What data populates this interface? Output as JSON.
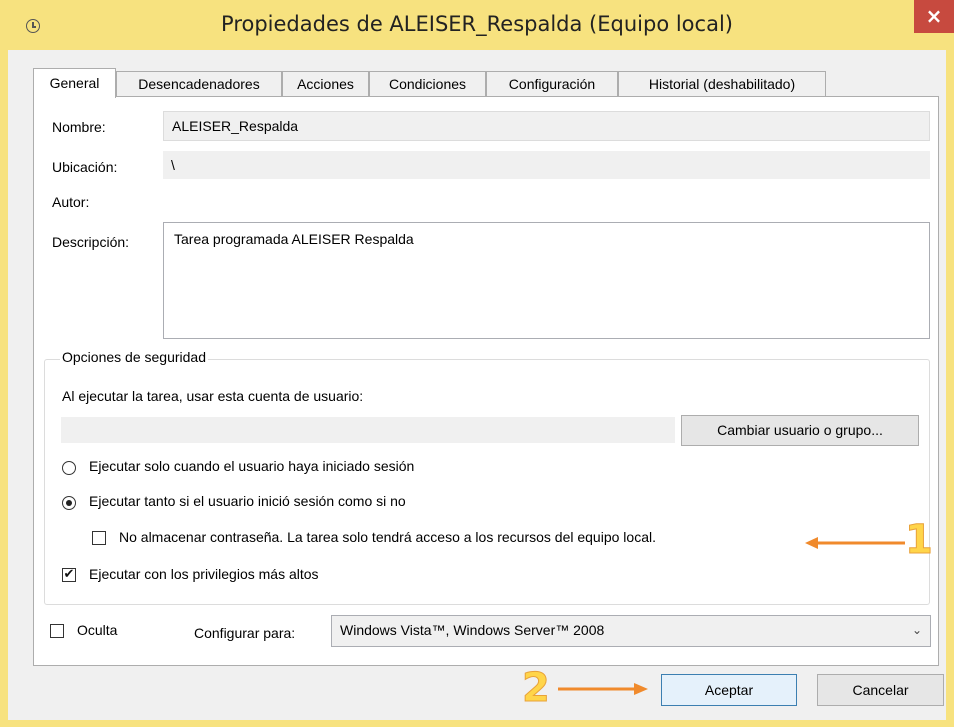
{
  "window": {
    "title": "Propiedades de ALEISER_Respalda (Equipo local)",
    "close_glyph": "×",
    "clock_icon": "clock-icon"
  },
  "tabs": [
    {
      "label": "General",
      "active": true
    },
    {
      "label": "Desencadenadores",
      "active": false
    },
    {
      "label": "Acciones",
      "active": false
    },
    {
      "label": "Condiciones",
      "active": false
    },
    {
      "label": "Configuración",
      "active": false
    },
    {
      "label": "Historial (deshabilitado)",
      "active": false
    }
  ],
  "general": {
    "name_label": "Nombre:",
    "name_value": "ALEISER_Respalda",
    "location_label": "Ubicación:",
    "location_value": "\\",
    "author_label": "Autor:",
    "author_value": "",
    "description_label": "Descripción:",
    "description_value": "Tarea programada ALEISER Respalda"
  },
  "security": {
    "group_title": "Opciones de seguridad",
    "account_prompt": "Al ejecutar la tarea, usar esta cuenta de usuario:",
    "account_value": "",
    "change_user_button": "Cambiar usuario o grupo...",
    "radio_logged_on": "Ejecutar solo cuando el usuario haya iniciado sesión",
    "radio_logged_on_selected": false,
    "radio_either": "Ejecutar tanto si el usuario inició sesión como si no",
    "radio_either_selected": true,
    "no_store_password": "No almacenar contraseña. La tarea solo tendrá acceso a los recursos del equipo local.",
    "no_store_password_checked": false,
    "highest_privileges": "Ejecutar con los privilegios más altos",
    "highest_privileges_checked": true
  },
  "footer": {
    "hidden_label": "Oculta",
    "hidden_checked": false,
    "configure_for_label": "Configurar para:",
    "configure_for_value": "Windows Vista™, Windows Server™ 2008",
    "ok_button": "Aceptar",
    "cancel_button": "Cancelar"
  },
  "annotations": {
    "marker_1": "1",
    "marker_2": "2",
    "color": "#f08a2c"
  },
  "colors": {
    "frame": "#f7e27f",
    "close_button": "#c74a3f",
    "client_bg": "#f0f0f0"
  }
}
